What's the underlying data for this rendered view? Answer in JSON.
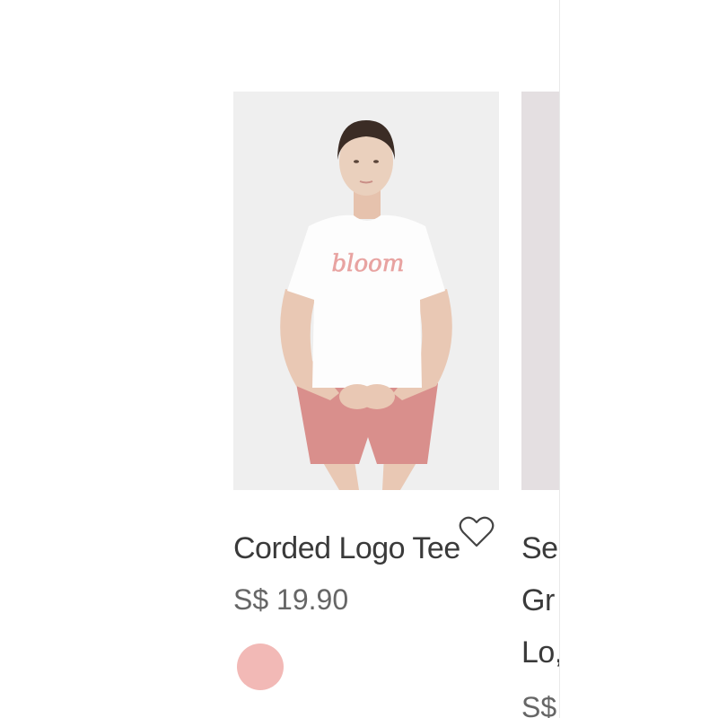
{
  "products": [
    {
      "title": "Corded Logo Tee",
      "price": "S$ 19.90",
      "swatch_color": "#f2b9b6",
      "shirt_print": "bloom",
      "wishlist_icon": "heart-outline-icon"
    },
    {
      "title": "Se… Gr… Lo…",
      "title_lines": [
        "Se",
        "Gr",
        "Lo,"
      ],
      "price": "S$"
    }
  ],
  "colors": {
    "image_bg": "#efefef",
    "text": "#3a3a3a",
    "price": "#666666",
    "shorts": "#d98f8c"
  }
}
